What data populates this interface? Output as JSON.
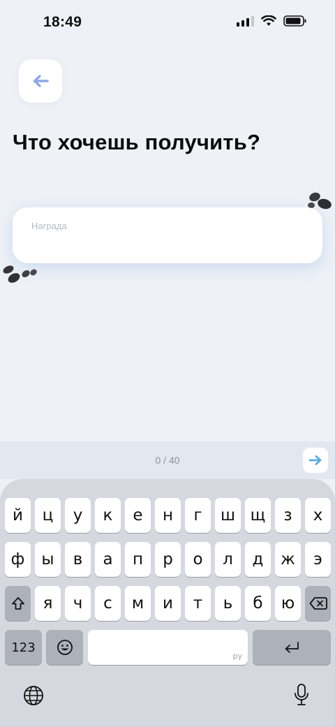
{
  "status_bar": {
    "time": "18:49"
  },
  "header": {
    "title": "Что хочешь получить?"
  },
  "reward_field": {
    "label": "Награда",
    "value": ""
  },
  "accessory": {
    "counter": "0 / 40"
  },
  "colors": {
    "background": "#eef1f6",
    "accent_back_arrow": "#8fa8e6",
    "accent_next_arrow": "#5aa8e0",
    "keyboard_bg": "#d5d8de"
  },
  "keyboard": {
    "row1": [
      "й",
      "ц",
      "у",
      "к",
      "е",
      "н",
      "г",
      "ш",
      "щ",
      "з",
      "х"
    ],
    "row2": [
      "ф",
      "ы",
      "в",
      "а",
      "п",
      "р",
      "о",
      "л",
      "д",
      "ж",
      "э"
    ],
    "row3": [
      "я",
      "ч",
      "с",
      "м",
      "и",
      "т",
      "ь",
      "б",
      "ю"
    ],
    "numbers_key": "123",
    "space_hint": "ру"
  },
  "icons": [
    "back-arrow-icon",
    "next-arrow-icon",
    "shift-icon",
    "backspace-icon",
    "emoji-icon",
    "return-icon",
    "globe-icon",
    "microphone-icon",
    "wifi-icon",
    "battery-icon",
    "signal-icon"
  ]
}
